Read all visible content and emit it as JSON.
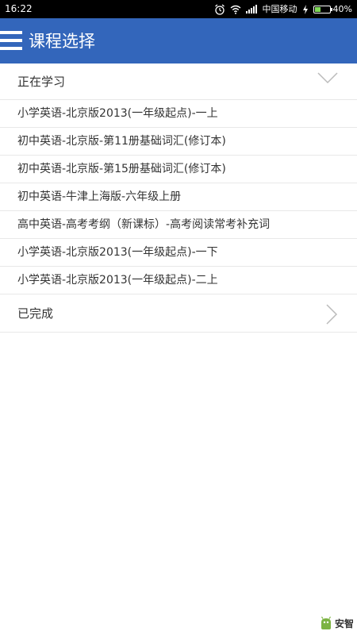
{
  "status_bar": {
    "time": "16:22",
    "carrier": "中国移动",
    "battery_percent_text": "40%",
    "battery_level": 0.4,
    "icons": [
      "alarm-icon",
      "wifi-icon",
      "signal-icon",
      "charging-icon",
      "battery-icon"
    ]
  },
  "app_bar": {
    "title": "课程选择",
    "menu_icon": "menu-icon",
    "background_color": "#3366bb"
  },
  "sections": {
    "in_progress": {
      "label": "正在学习",
      "expanded": true,
      "icon": "chevron-down-icon"
    },
    "completed": {
      "label": "已完成",
      "expanded": false,
      "icon": "chevron-right-icon"
    }
  },
  "courses": [
    {
      "label": "小学英语-北京版2013(一年级起点)-一上"
    },
    {
      "label": "初中英语-北京版-第11册基础词汇(修订本)"
    },
    {
      "label": "初中英语-北京版-第15册基础词汇(修订本)"
    },
    {
      "label": "初中英语-牛津上海版-六年级上册"
    },
    {
      "label": "高中英语-高考考纲（新课标）-高考阅读常考补充词"
    },
    {
      "label": "小学英语-北京版2013(一年级起点)-一下"
    },
    {
      "label": "小学英语-北京版2013(一年级起点)-二上"
    }
  ],
  "watermark": {
    "text": "安智",
    "icon": "anzhi-logo-icon"
  }
}
